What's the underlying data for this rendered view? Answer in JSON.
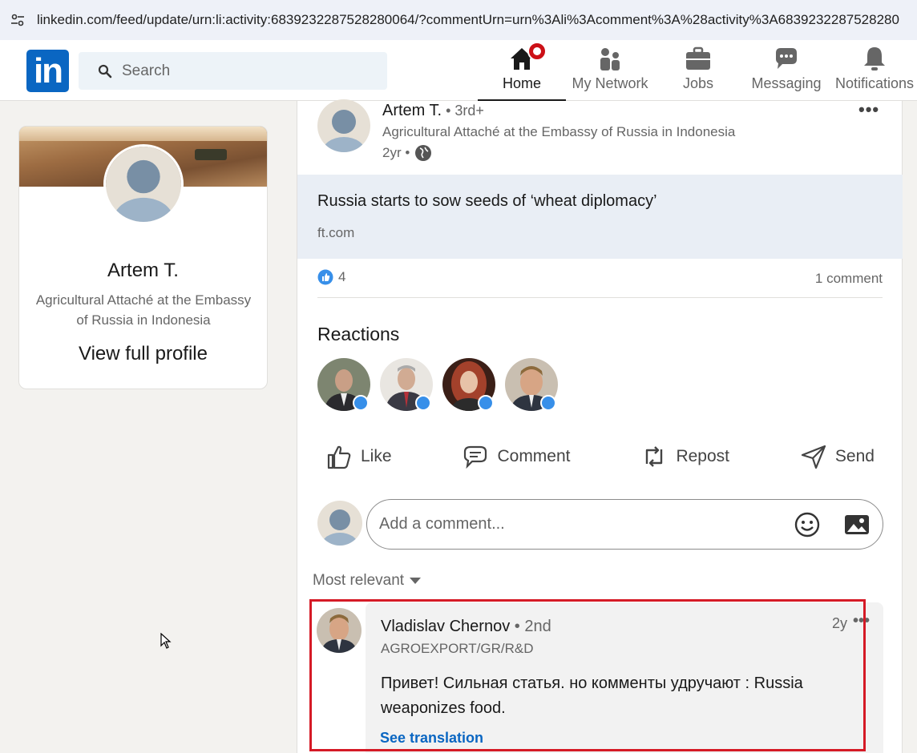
{
  "browser": {
    "url": "linkedin.com/feed/update/urn:li:activity:6839232287528280064/?commentUrn=urn%3Ali%3Acomment%3A%28activity%3A6839232287528280"
  },
  "nav": {
    "logo": "in",
    "search_placeholder": "Search",
    "items": [
      {
        "label": "Home",
        "icon": "home-icon",
        "active": true
      },
      {
        "label": "My Network",
        "icon": "network-icon"
      },
      {
        "label": "Jobs",
        "icon": "briefcase-icon"
      },
      {
        "label": "Messaging",
        "icon": "chat-icon"
      },
      {
        "label": "Notifications",
        "icon": "bell-icon"
      }
    ]
  },
  "profile": {
    "name": "Artem T.",
    "headline": "Agricultural Attaché at the Embassy of Russia in Indonesia",
    "view_label": "View full profile"
  },
  "post": {
    "author": "Artem T.",
    "degree": " • 3rd+",
    "headline": "Agricultural Attaché at the Embassy of Russia in Indonesia",
    "time": "2yr •",
    "more": "•••",
    "article_title": "Russia starts to sow seeds of ‘wheat diplomacy’",
    "article_source": "ft.com",
    "like_count": "4",
    "comment_count": "1 comment",
    "reactions_title": "Reactions",
    "actions": {
      "like": "Like",
      "comment": "Comment",
      "repost": "Repost",
      "send": "Send"
    },
    "comment_placeholder": "Add a comment...",
    "sort_label": "Most relevant"
  },
  "comment": {
    "author": "Vladislav Chernov",
    "degree": " • 2nd",
    "subtitle": "AGROEXPORT/GR/R&D",
    "time": "2y",
    "more": "•••",
    "text": "Привет! Сильная статья. но комменты удручают : Russia weaponizes food.",
    "translate_label": "See translation"
  },
  "colors": {
    "brand": "#0a66c2",
    "highlight_border": "#d51a26",
    "badge": "#cc1016"
  }
}
